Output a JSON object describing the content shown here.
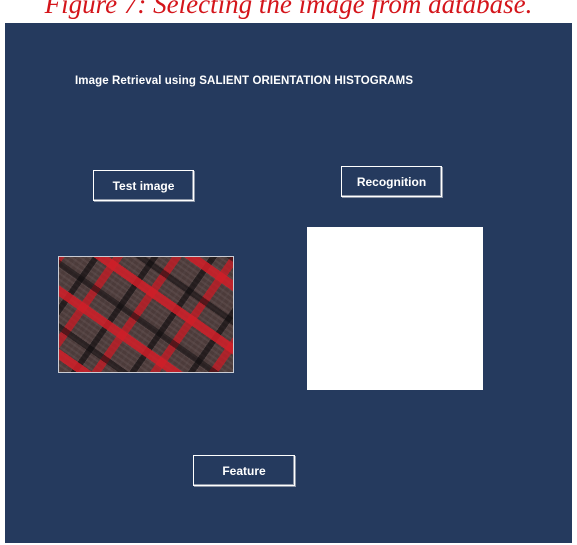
{
  "caption": {
    "text": "Figure 7: Selecting the image from database."
  },
  "window": {
    "title": "Image Retrieval using SALIENT ORIENTATION HISTOGRAMS",
    "background_color": "#253a5e"
  },
  "buttons": {
    "test_image": "Test image",
    "recognition": "Recognition",
    "feature": "Feature"
  },
  "panels": {
    "test_image_preview": "red-black-plaid-fabric-image",
    "recognition_result": "empty-white-panel"
  },
  "colors": {
    "caption": "#d4151b",
    "button_border": "#ffffff",
    "text": "#ffffff"
  }
}
